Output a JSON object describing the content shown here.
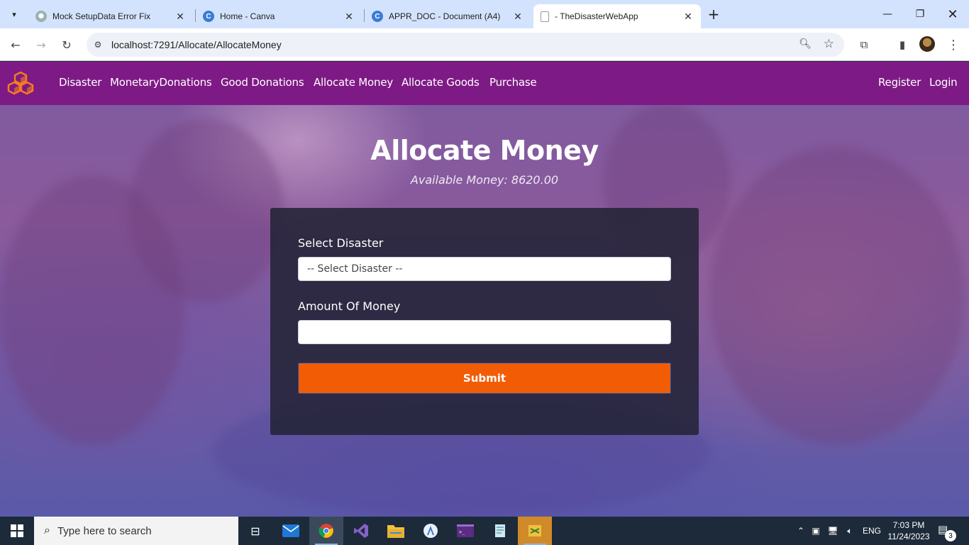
{
  "browser": {
    "tabs": [
      {
        "title": "Mock SetupData Error Fix",
        "icon": "chatgpt-icon"
      },
      {
        "title": "Home - Canva",
        "icon": "canva-icon"
      },
      {
        "title": "APPR_DOC - Document (A4)",
        "icon": "canva-icon"
      },
      {
        "title": "- TheDisasterWebApp",
        "icon": "page-icon",
        "active": true
      }
    ],
    "url": "localhost:7291/Allocate/AllocateMoney"
  },
  "navbar": {
    "links": [
      "Disaster",
      "MonetaryDonations",
      "Good Donations",
      "Allocate Money",
      "Allocate Goods",
      "Purchase"
    ],
    "auth": [
      "Register",
      "Login"
    ],
    "color": "#7e1a85"
  },
  "main": {
    "title": "Allocate Money",
    "subtitle": "Available Money: 8620.00",
    "form": {
      "disaster_label": "Select Disaster",
      "disaster_selected": "-- Select Disaster --",
      "amount_label": "Amount Of Money",
      "amount_value": "",
      "submit_label": "Submit",
      "submit_color": "#f25c05"
    }
  },
  "taskbar": {
    "search_placeholder": "Type here to search",
    "language": "ENG",
    "time": "7:03 PM",
    "date": "11/24/2023",
    "notification_count": "3"
  }
}
